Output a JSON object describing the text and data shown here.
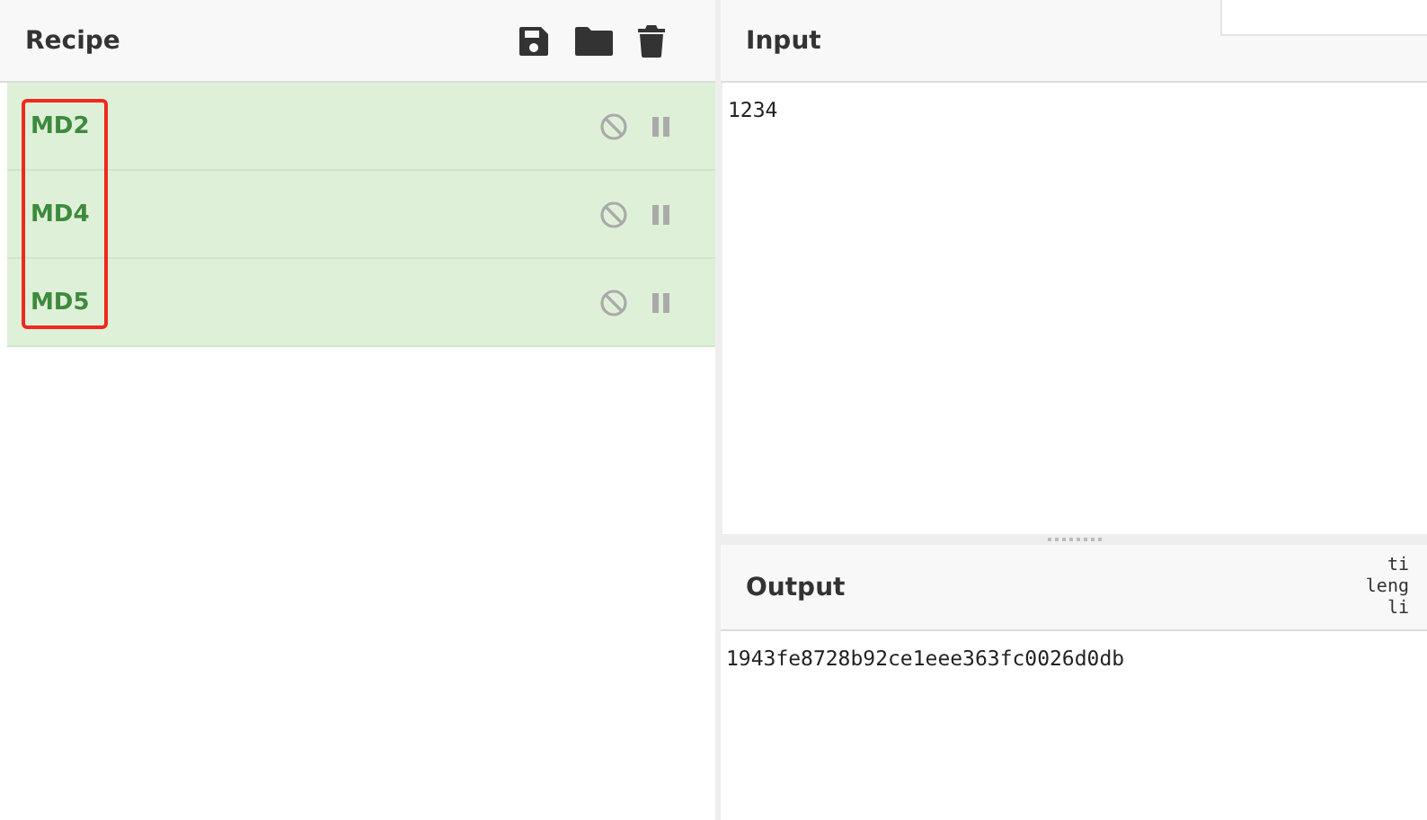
{
  "recipe": {
    "title": "Recipe",
    "operations": [
      {
        "name": "MD2"
      },
      {
        "name": "MD4"
      },
      {
        "name": "MD5"
      }
    ]
  },
  "input": {
    "title": "Input",
    "value": "1234"
  },
  "output": {
    "title": "Output",
    "stats": [
      "ti",
      "leng",
      "li"
    ],
    "value": "1943fe8728b92ce1eee363fc0026d0db"
  }
}
